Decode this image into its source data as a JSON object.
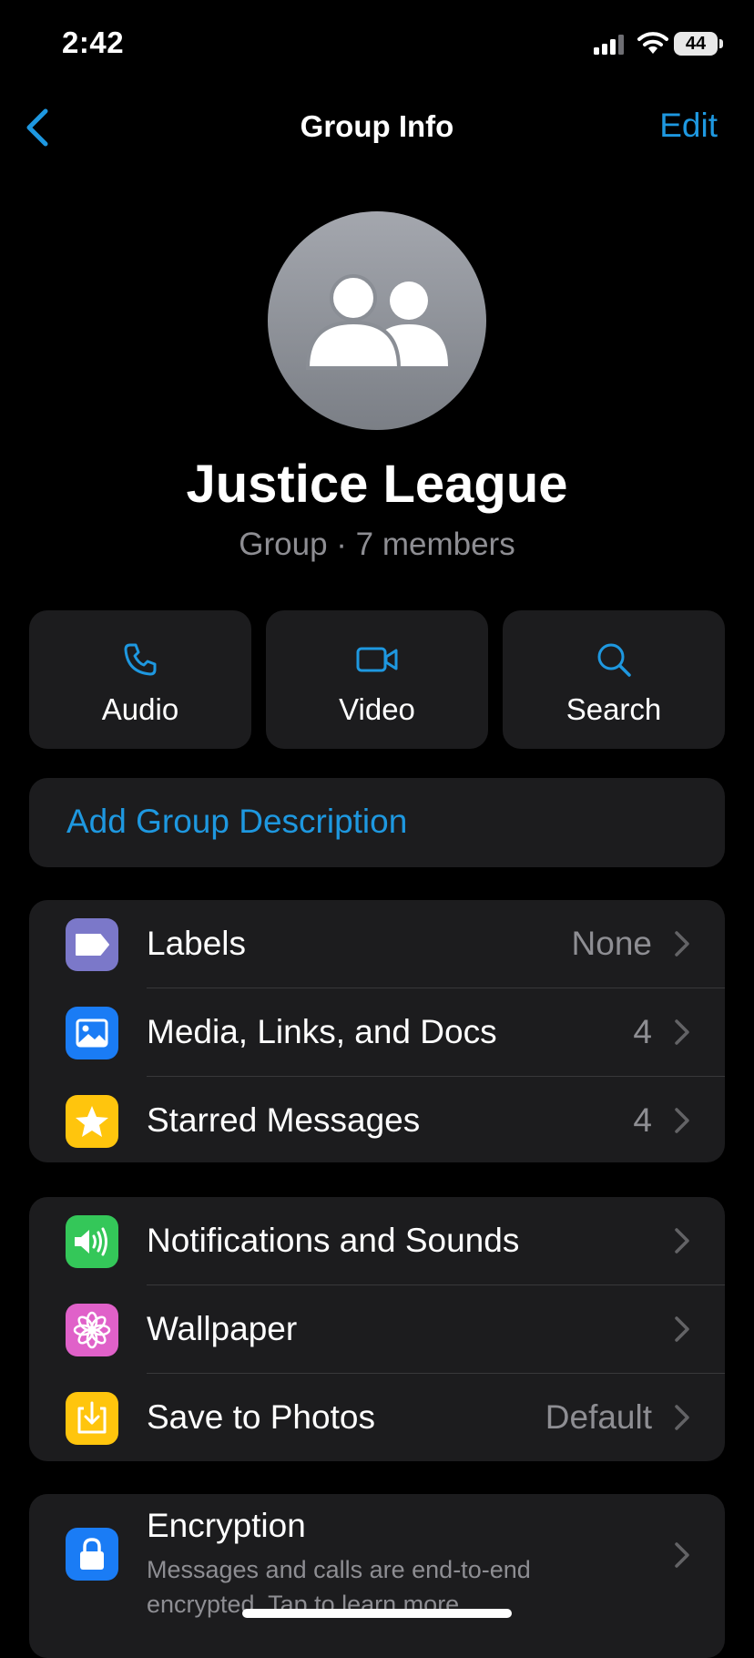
{
  "status_bar": {
    "time": "2:42",
    "battery": "44"
  },
  "nav": {
    "title": "Group Info",
    "edit_label": "Edit"
  },
  "group": {
    "name": "Justice League",
    "subtitle": "Group · 7 members"
  },
  "actions": [
    {
      "label": "Audio",
      "icon": "phone-icon"
    },
    {
      "label": "Video",
      "icon": "video-camera-icon"
    },
    {
      "label": "Search",
      "icon": "magnifier-icon"
    }
  ],
  "description": {
    "label": "Add Group Description"
  },
  "section1": [
    {
      "label": "Labels",
      "value": "None",
      "icon": "label-tag-icon",
      "color": "#7b78c9"
    },
    {
      "label": "Media, Links, and Docs",
      "value": "4",
      "icon": "photo-icon",
      "color": "#1a7cf5"
    },
    {
      "label": "Starred Messages",
      "value": "4",
      "icon": "star-icon",
      "color": "#ffc50d"
    }
  ],
  "section2": [
    {
      "label": "Notifications and Sounds",
      "value": "",
      "icon": "speaker-icon",
      "color": "#34c759"
    },
    {
      "label": "Wallpaper",
      "value": "",
      "icon": "flower-icon",
      "color": "#e061c9"
    },
    {
      "label": "Save to Photos",
      "value": "Default",
      "icon": "download-icon",
      "color": "#ffc50d"
    }
  ],
  "encryption": {
    "title": "Encryption",
    "description": "Messages and calls are end-to-end encrypted. Tap to learn more.",
    "icon": "lock-icon",
    "color": "#1a7cf5"
  },
  "colors": {
    "accent": "#1e98e0",
    "card": "#1c1c1e",
    "secondary_text": "#8e8e93"
  }
}
